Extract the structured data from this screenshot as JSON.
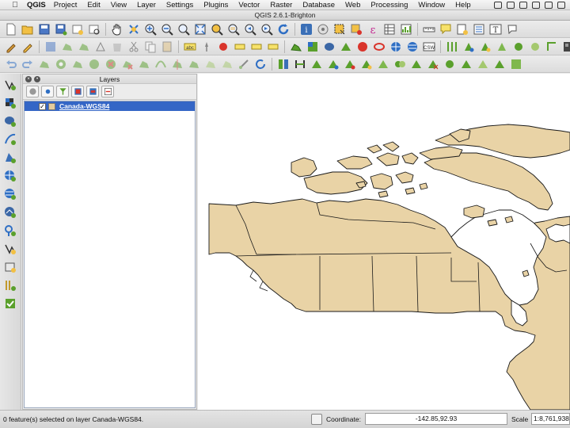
{
  "menubar": {
    "app_name": "QGIS",
    "items": [
      "Project",
      "Edit",
      "View",
      "Layer",
      "Settings",
      "Plugins",
      "Vector",
      "Raster",
      "Database",
      "Web",
      "Processing",
      "Window",
      "Help"
    ]
  },
  "window": {
    "title": "QGIS 2.6.1-Brighton"
  },
  "toolbar3": {
    "csw_label": "CSW"
  },
  "layers_panel": {
    "title": "Layers",
    "layers": [
      {
        "name": "Canada-WGS84",
        "visible": true,
        "symbol_color": "#e4cb9d"
      }
    ]
  },
  "map": {
    "land_color": "#e9d3a6",
    "water_color": "#ffffff",
    "stroke_color": "#1a1a1a"
  },
  "statusbar": {
    "message": "0 feature(s) selected on layer Canada-WGS84.",
    "coordinate_label": "Coordinate:",
    "coordinate_value": "-142.85,92.93",
    "scale_label": "Scale",
    "scale_value": "1:8,761,938"
  },
  "colors": {
    "selection": "#3466c6",
    "accent_green": "#5aa02c",
    "accent_blue": "#2f6fc4"
  }
}
